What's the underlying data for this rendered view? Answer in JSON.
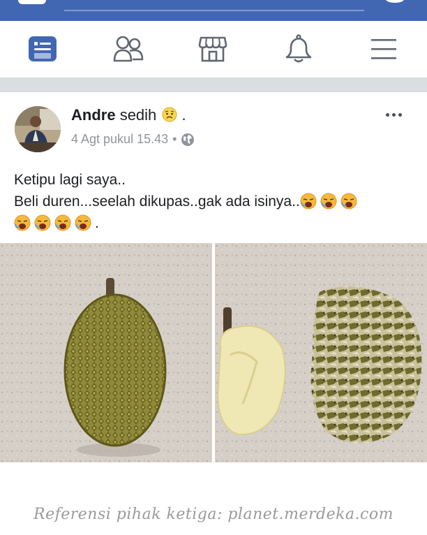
{
  "post": {
    "author": "Andre",
    "feeling": "sedih",
    "feeling_suffix": ".",
    "timestamp": "4 Agt pukul 15.43",
    "separator": "•",
    "text_line1": "Ketipu lagi saya..",
    "text_line2": "Beli duren...seelah dikupas..gak ada isinya..",
    "text_suffix": "."
  },
  "navbar": {
    "items": [
      "news-feed",
      "friends",
      "marketplace",
      "notifications",
      "menu"
    ],
    "active": "news-feed",
    "active_color": "#4267b2"
  },
  "colors": {
    "topbar": "#4267b2",
    "divider": "#dadde1"
  },
  "watermark": "Referensi pihak ketiga: planet.merdeka.com"
}
